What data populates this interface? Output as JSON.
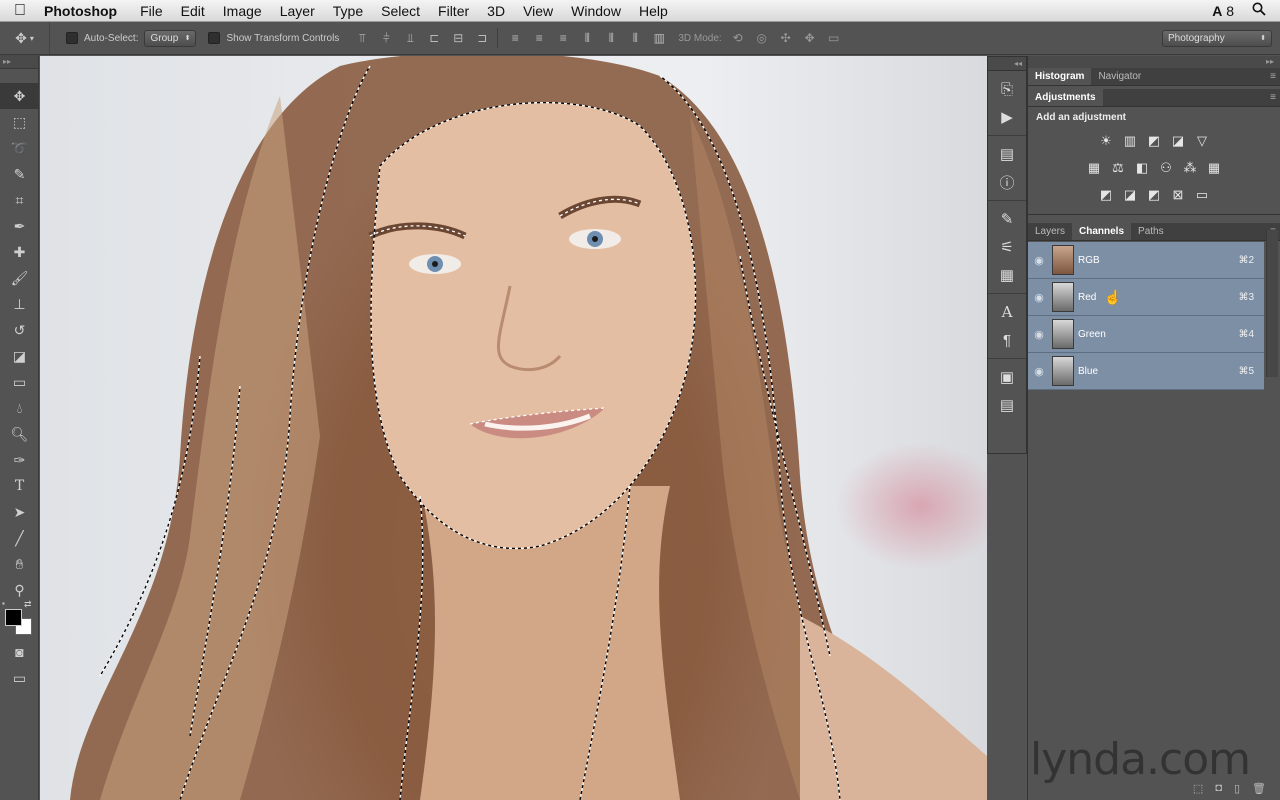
{
  "menubar": {
    "apple": "",
    "app_name": "Photoshop",
    "items": [
      "File",
      "Edit",
      "Image",
      "Layer",
      "Type",
      "Select",
      "Filter",
      "3D",
      "View",
      "Window",
      "Help"
    ],
    "status_count": "8"
  },
  "options": {
    "auto_select_label": "Auto-Select:",
    "auto_select_value": "Group",
    "transform_label": "Show Transform Controls",
    "mode3d_label": "3D Mode:",
    "workspace": "Photography"
  },
  "tools": [
    "move-tool",
    "marquee-tool",
    "lasso-tool",
    "quick-selection-tool",
    "crop-tool",
    "eyedropper-tool",
    "healing-brush-tool",
    "brush-tool",
    "clone-stamp-tool",
    "history-brush-tool",
    "eraser-tool",
    "gradient-tool",
    "blur-tool",
    "dodge-tool",
    "pen-tool",
    "type-tool",
    "path-selection-tool",
    "line-tool",
    "hand-tool",
    "zoom-tool"
  ],
  "colors": {
    "foreground": "#000000",
    "background": "#ffffff",
    "channel_highlight": "#7d8fa5"
  },
  "panels": {
    "top_tabs": [
      "Histogram",
      "Navigator"
    ],
    "adjustments_tab": "Adjustments",
    "adjustments_title": "Add an adjustment",
    "lower_tabs": [
      "Layers",
      "Channels",
      "Paths"
    ],
    "active_lower_tab": "Channels"
  },
  "channels": [
    {
      "name": "RGB",
      "shortcut": "⌘2"
    },
    {
      "name": "Red",
      "shortcut": "⌘3"
    },
    {
      "name": "Green",
      "shortcut": "⌘4"
    },
    {
      "name": "Blue",
      "shortcut": "⌘5"
    }
  ],
  "watermark": "lynda.com"
}
